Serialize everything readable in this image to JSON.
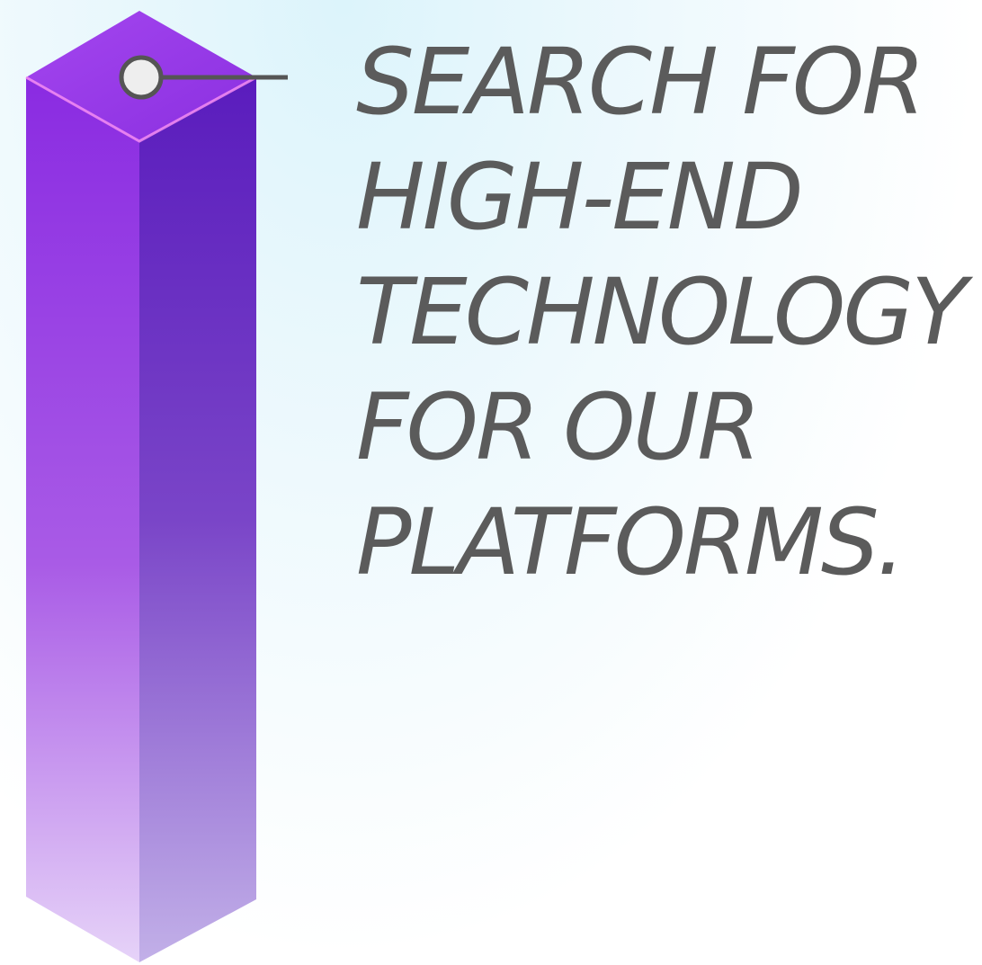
{
  "headline": {
    "lines": [
      "SEARCH FOR",
      "HIGH-END",
      "TECHNOLOGY",
      "FOR OUR",
      "PLATFORMS."
    ]
  },
  "colors": {
    "text": "#5b5b5b",
    "pillar_top": "#a93ef0",
    "pillar_left_top": "#8a2be2",
    "pillar_left_bottom": "#e1c9f7",
    "pillar_right_top": "#5f1fc0",
    "pillar_right_bottom": "#bca8e6",
    "pillar_edge": "#f58ff0",
    "marker_fill": "#eeeeee",
    "connector": "#555555"
  }
}
